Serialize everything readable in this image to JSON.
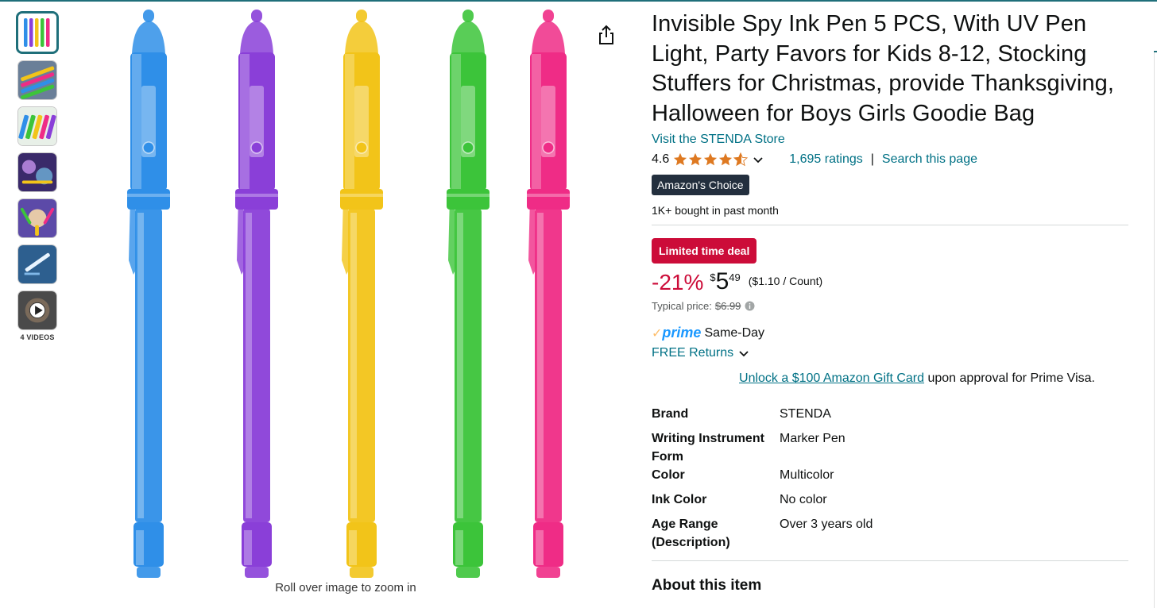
{
  "thumbnails": {
    "items": [
      {
        "name": "thumb-pens",
        "active": true
      },
      {
        "name": "thumb-writing",
        "active": false
      },
      {
        "name": "thumb-colors",
        "active": false
      },
      {
        "name": "thumb-uv-light",
        "active": false
      },
      {
        "name": "thumb-hands",
        "active": false
      },
      {
        "name": "thumb-demo",
        "active": false
      },
      {
        "name": "thumb-video",
        "active": false
      }
    ],
    "video_label": "4 VIDEOS"
  },
  "main_image": {
    "zoom_hint": "Roll over image to zoom in",
    "pen_colors": [
      "#2f8fe8",
      "#8a3fd8",
      "#f2c419",
      "#3cc43a",
      "#ef2c86"
    ]
  },
  "product": {
    "title": "Invisible Spy Ink Pen 5 PCS, With UV Pen Light, Party Favors for Kids 8-12, Stocking Stuffers for Christmas, provide Thanksgiving, Halloween for Boys Girls Goodie Bag",
    "store_link": "Visit the STENDA Store",
    "rating": "4.6",
    "ratings_count": "1,695 ratings",
    "separator": "|",
    "search_page": "Search this page",
    "choice_badge": "Amazon's Choice",
    "bought": "1K+ bought in past month"
  },
  "pricing": {
    "deal_badge": "Limited time deal",
    "discount": "-21%",
    "currency": "$",
    "price_whole": "5",
    "price_fraction": "49",
    "per_unit": "($1.10 / Count)",
    "typical_label": "Typical price:",
    "typical_price": "$6.99"
  },
  "delivery": {
    "prime_word": "prime",
    "prime_speed": "Same-Day",
    "returns": "FREE Returns"
  },
  "promo": {
    "link": "Unlock a $100 Amazon Gift Card",
    "rest": " upon approval for Prime Visa."
  },
  "specs": [
    {
      "key": "Brand",
      "value": "STENDA"
    },
    {
      "key": "Writing Instrument Form",
      "value": "Marker Pen"
    },
    {
      "key": "Color",
      "value": "Multicolor"
    },
    {
      "key": "Ink Color",
      "value": "No color"
    },
    {
      "key": "Age Range (Description)",
      "value": "Over 3 years old"
    }
  ],
  "about_heading": "About this item",
  "colors": {
    "link": "#007185",
    "deal_red": "#cc0c39",
    "star": "#de7921",
    "badge_dark": "#232f3e",
    "thumb_active": "#1f6f7a"
  }
}
